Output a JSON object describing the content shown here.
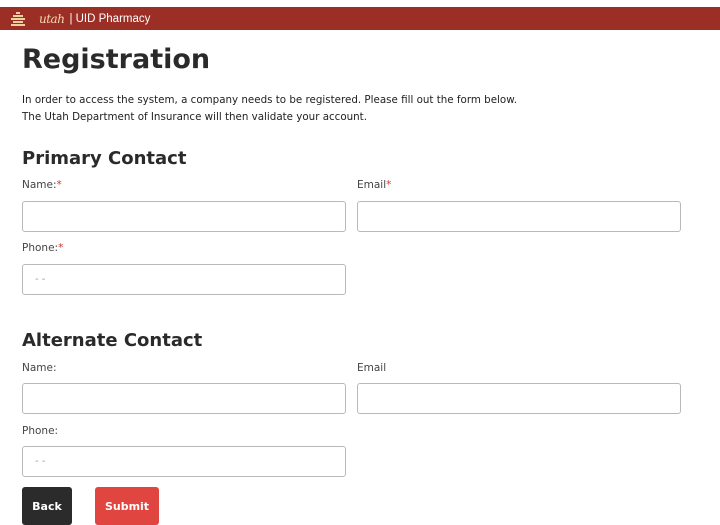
{
  "header": {
    "logo_text": "utah",
    "app_name": "| UID Pharmacy",
    "bar_color": "#9c2f25"
  },
  "page": {
    "title": "Registration",
    "intro_line1": "In order to access the system, a company needs to be registered. Please fill out the form below.",
    "intro_line2": "The Utah Department of Insurance will then validate your account."
  },
  "primary": {
    "heading": "Primary Contact",
    "name_label": "Name:",
    "email_label": "Email",
    "phone_label": "Phone:",
    "required_mark": "*",
    "name_value": "",
    "email_value": "",
    "phone_placeholder": "- -"
  },
  "alternate": {
    "heading": "Alternate Contact",
    "name_label": "Name:",
    "email_label": "Email",
    "phone_label": "Phone:",
    "name_value": "",
    "email_value": "",
    "phone_placeholder": "- -"
  },
  "actions": {
    "back_label": "Back",
    "submit_label": "Submit",
    "back_color": "#2b2b2b",
    "submit_color": "#e0453f"
  }
}
